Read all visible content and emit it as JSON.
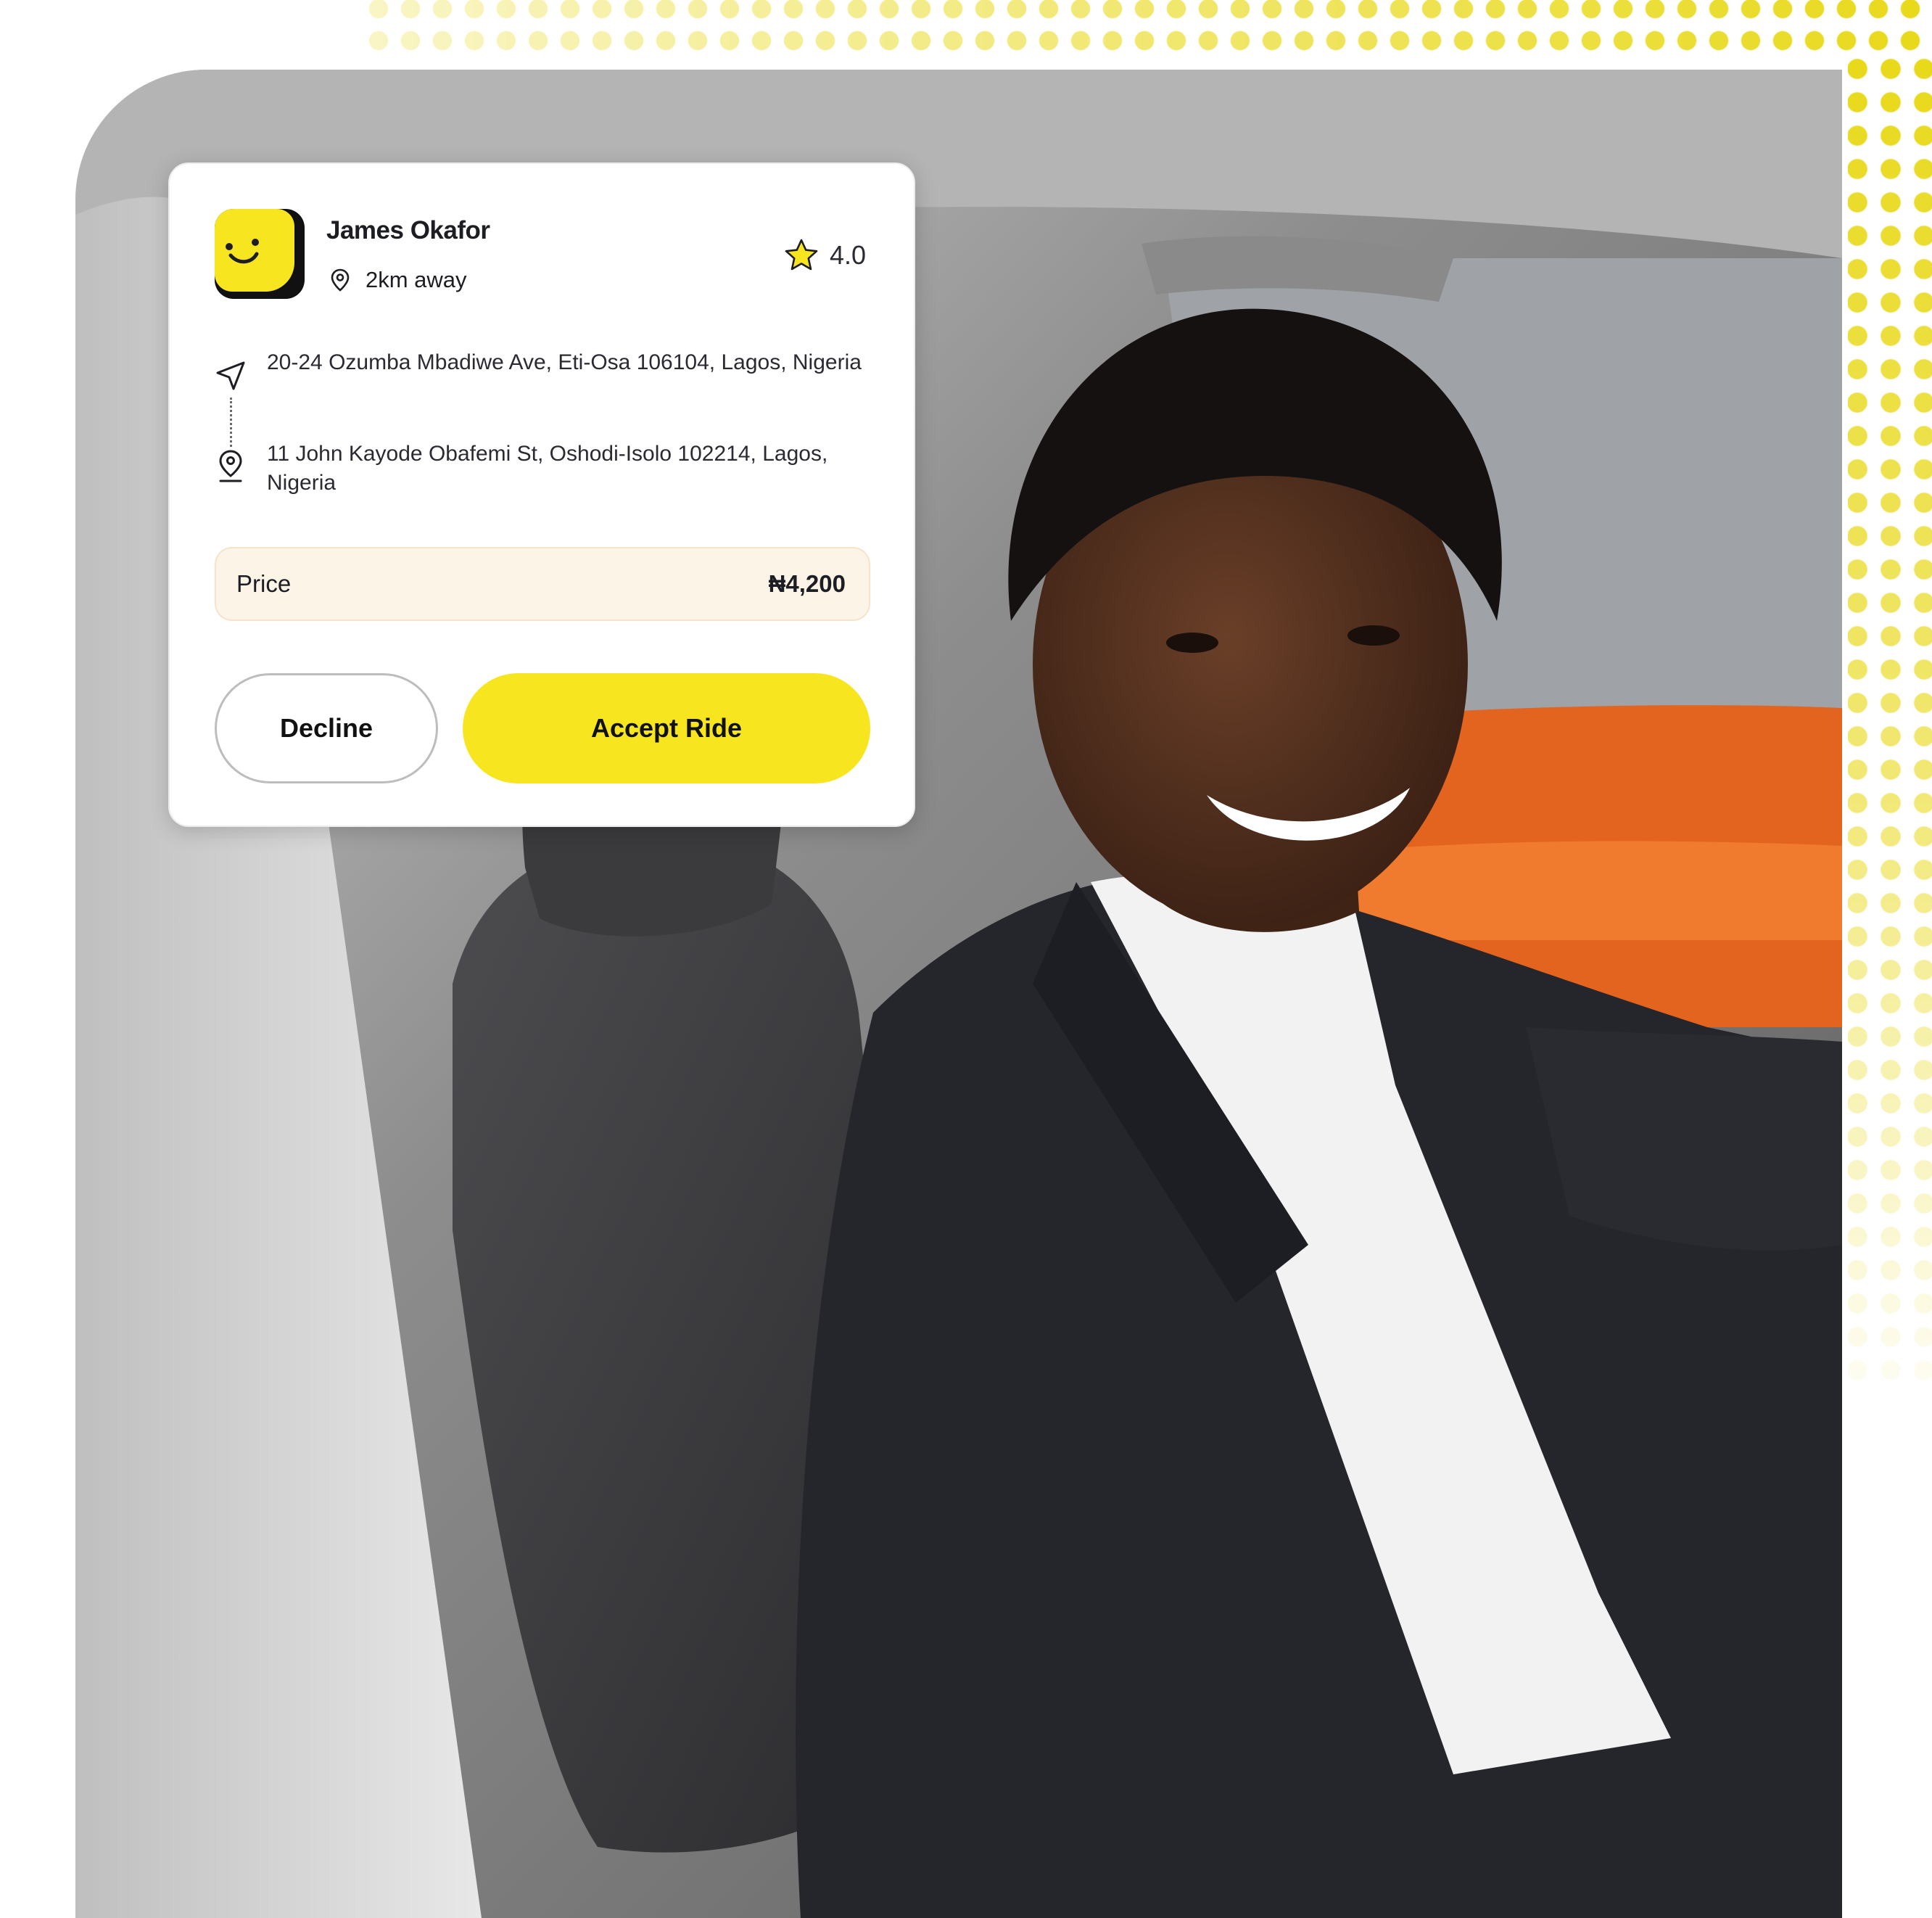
{
  "driver": {
    "name": "James Okafor",
    "distance": "2km away",
    "rating": "4.0"
  },
  "route": {
    "pickup": "20-24 Ozumba Mbadiwe Ave, Eti-Osa 106104, Lagos, Nigeria",
    "dropoff": "11 John Kayode Obafemi St, Oshodi-Isolo 102214, Lagos, Nigeria"
  },
  "price": {
    "label": "Price",
    "value": "₦4,200"
  },
  "actions": {
    "decline_label": "Decline",
    "accept_label": "Accept Ride"
  },
  "icons": {
    "avatar": "smiley-avatar-icon",
    "distance": "map-pin-icon",
    "rating": "star-icon",
    "pickup": "navigation-arrow-icon",
    "dropoff": "location-pin-icon"
  },
  "colors": {
    "accent": "#F7E61F",
    "price_bg": "#FDF4E8",
    "text": "#1d1d24",
    "dots": "#E8D91A"
  }
}
